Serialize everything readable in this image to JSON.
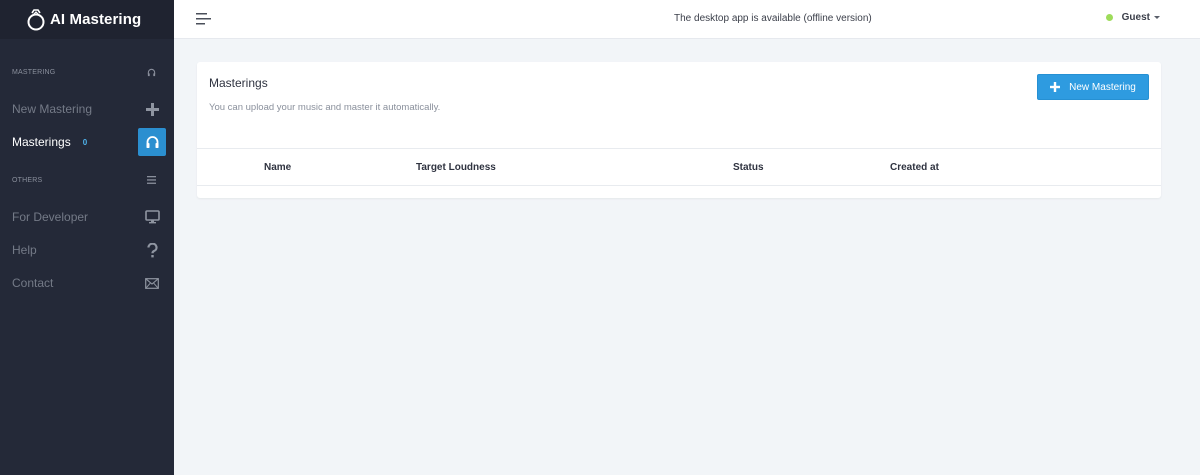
{
  "app": {
    "title": "AI Mastering"
  },
  "sidebar": {
    "sections": [
      {
        "label": "MASTERING",
        "icon": "headphones-icon"
      },
      {
        "label": "OTHERS",
        "icon": "list-icon"
      }
    ],
    "items": [
      {
        "label": "New Mastering",
        "icon": "plus-icon",
        "active": false
      },
      {
        "label": "Masterings",
        "badge": "0",
        "icon": "headphones-icon",
        "active": true
      },
      {
        "label": "For Developer",
        "icon": "monitor-icon",
        "active": false
      },
      {
        "label": "Help",
        "icon": "question-icon",
        "active": false
      },
      {
        "label": "Contact",
        "icon": "mail-icon",
        "active": false
      }
    ]
  },
  "topbar": {
    "notice": "The desktop app is available (offline version)",
    "user": "Guest",
    "status_color": "#9edc5a"
  },
  "main": {
    "title": "Masterings",
    "subtitle": "You can upload your music and master it automatically.",
    "new_button": "New Mastering",
    "columns": [
      "Name",
      "Target Loudness",
      "Status",
      "Created at"
    ]
  },
  "colors": {
    "accent": "#2e9be0",
    "sidebar_bg": "#242938",
    "badge": "#4fb3ec"
  }
}
